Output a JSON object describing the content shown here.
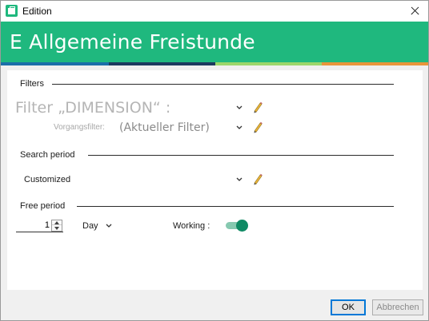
{
  "window": {
    "title": "Edition",
    "header_title": "E Allgemeine Freistunde"
  },
  "colors": {
    "brand_green": "#1fb87e",
    "stripes": [
      "#1b6fa8",
      "#1c3a5e",
      "#9bd66a",
      "#e8953a"
    ],
    "toggle_on": "#0f8a64"
  },
  "filters": {
    "section_title": "Filters",
    "filter_label": "Filter „DIMENSION“ :",
    "sub_label": "Vorgangsfilter:",
    "sub_value": "(Aktueller Filter)"
  },
  "search_period": {
    "section_title": "Search period",
    "selected": "Customized"
  },
  "free_period": {
    "section_title": "Free period",
    "amount": "1",
    "unit": "Day",
    "working_label": "Working :",
    "working_on": true
  },
  "buttons": {
    "ok": "OK",
    "cancel": "Abbrechen"
  },
  "icons": {
    "close": "close-icon",
    "app": "app-icon",
    "chevron": "chevron-down-icon",
    "pencil": "pencil-icon",
    "spin_up": "arrow-up-icon",
    "spin_down": "arrow-down-icon"
  }
}
